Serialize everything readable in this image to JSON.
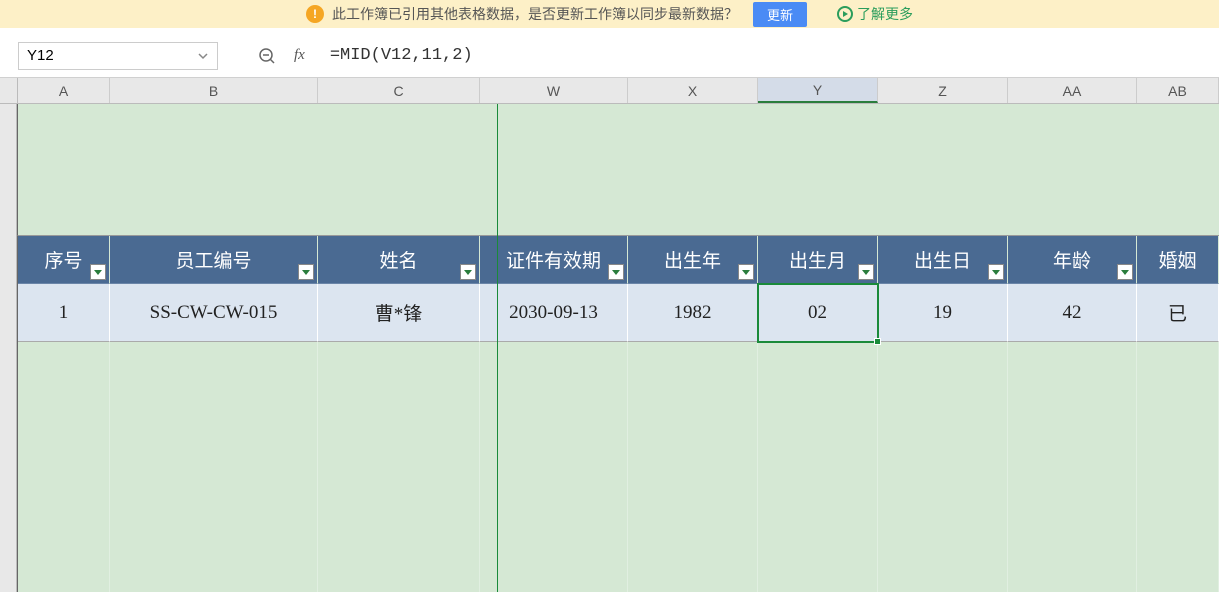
{
  "notification": {
    "text": "此工作簿已引用其他表格数据，是否更新工作簿以同步最新数据？",
    "update_btn": "更新",
    "learn_more": "了解更多"
  },
  "formula_bar": {
    "cell_name": "Y12",
    "fx_label": "fx",
    "formula": "=MID(V12,11,2)"
  },
  "columns": [
    {
      "letter": "A",
      "class": "w-a"
    },
    {
      "letter": "B",
      "class": "w-b"
    },
    {
      "letter": "C",
      "class": "w-c"
    },
    {
      "letter": "W",
      "class": "w-w"
    },
    {
      "letter": "X",
      "class": "w-x"
    },
    {
      "letter": "Y",
      "class": "w-y",
      "selected": true
    },
    {
      "letter": "Z",
      "class": "w-z"
    },
    {
      "letter": "AA",
      "class": "w-aa"
    },
    {
      "letter": "AB",
      "class": "w-ab"
    }
  ],
  "headers": {
    "a": "序号",
    "b": "员工编号",
    "c": "姓名",
    "w": "证件有效期",
    "x": "出生年",
    "y": "出生月",
    "z": "出生日",
    "aa": "年龄",
    "ab": "婚姻"
  },
  "data_row": {
    "a": "1",
    "b": "SS-CW-CW-015",
    "c": "曹*锋",
    "w": "2030-09-13",
    "x": "1982",
    "y": "02",
    "z": "19",
    "aa": "42",
    "ab": "已"
  },
  "chart_data": null
}
